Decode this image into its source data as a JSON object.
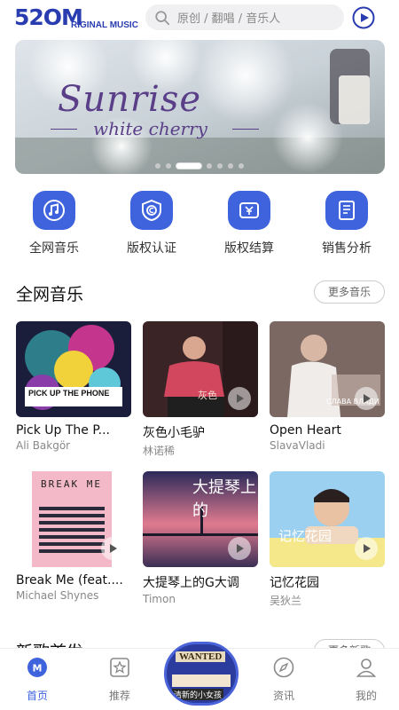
{
  "header": {
    "logo_big": "52OM",
    "logo_small": "RIGINAL MUSIC",
    "search_placeholder": "原创 / 翻唱 / 音乐人"
  },
  "banner": {
    "title": "Sunrise",
    "subtitle": "white cherry",
    "dots_count": 7,
    "active_dot": 3
  },
  "quick_nav": [
    {
      "label": "全网音乐",
      "icon": "music-note-icon"
    },
    {
      "label": "版权认证",
      "icon": "copyright-shield-icon"
    },
    {
      "label": "版权结算",
      "icon": "yuan-wallet-icon"
    },
    {
      "label": "销售分析",
      "icon": "ledger-book-icon"
    }
  ],
  "sections": {
    "all_music": {
      "title": "全网音乐",
      "more": "更多音乐"
    },
    "new_songs": {
      "title": "新歌首发",
      "more": "更多新歌"
    }
  },
  "songs": [
    {
      "title": "Pick Up The P...",
      "artist": "Ali Bakgör",
      "cover_text": "PICK UP THE PHONE",
      "colors": [
        "#1a1e3a",
        "#c4368d"
      ]
    },
    {
      "title": "灰色小毛驴",
      "artist": "林诺稀",
      "cover_text": "灰色",
      "colors": [
        "#3a2426",
        "#b54a5a"
      ]
    },
    {
      "title": "Open Heart",
      "artist": "SlavaVladi",
      "cover_text": "СЛАВА ВЛАДИ",
      "colors": [
        "#6d5a55",
        "#cdbbb3"
      ]
    },
    {
      "title": "Break Me (feat....",
      "artist": "Michael Shynes",
      "cover_text": "BREAK ME",
      "colors": [
        "#f4b9c8",
        "#2a2a3a"
      ]
    },
    {
      "title": "大提琴上的G大调",
      "artist": "Timon",
      "cover_text": "大提琴上的",
      "colors": [
        "#2a2a5a",
        "#e07a8f"
      ]
    },
    {
      "title": "记忆花园",
      "artist": "吴狄兰",
      "cover_text": "记忆花园",
      "colors": [
        "#9bd0f0",
        "#f4e88a"
      ]
    }
  ],
  "bottom_nav": [
    {
      "label": "首页",
      "icon": "home-icon",
      "active": true
    },
    {
      "label": "推荐",
      "icon": "star-icon",
      "active": false
    },
    {
      "label": "资讯",
      "icon": "compass-icon",
      "active": false
    },
    {
      "label": "我的",
      "icon": "user-icon",
      "active": false
    }
  ],
  "center_disc": {
    "top_text": "WANTED",
    "bottom_text": "清新的小女孩"
  },
  "colors": {
    "accent": "#3e63dd",
    "brand": "#2a3db0"
  }
}
